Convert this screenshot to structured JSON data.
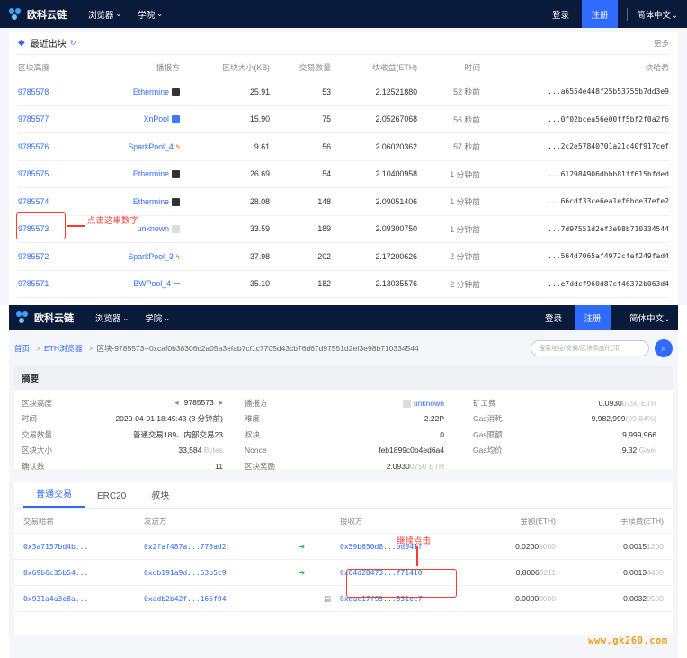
{
  "nav": {
    "logo": "欧科云链",
    "browser": "浏览器",
    "academy": "学院",
    "login": "登录",
    "register": "注册",
    "lang": "简体中文"
  },
  "recent": {
    "title": "最近出块",
    "more": "更多",
    "headers": [
      "区块高度",
      "播报方",
      "区块大小(KB)",
      "交易数量",
      "块收益(ETH)",
      "时间",
      "块哈希"
    ],
    "rows": [
      {
        "height": "9785578",
        "miner": "Ethermine",
        "icon": "dark",
        "size": "25.91",
        "txs": "53",
        "reward": "2.12521880",
        "time": "52 秒前",
        "hash": "...a6554e448f25b53755b7dd3e9"
      },
      {
        "height": "9785577",
        "miner": "XnPool",
        "icon": "blue",
        "size": "15.90",
        "txs": "75",
        "reward": "2.05267068",
        "time": "56 秒前",
        "hash": "...0f02bcea56e00ff5bf2f0a2f6"
      },
      {
        "height": "9785576",
        "miner": "SparkPool_4",
        "icon": "fire",
        "size": "9.61",
        "txs": "56",
        "reward": "2.06020362",
        "time": "57 秒前",
        "hash": "...2c2e57840701a21c40f917cef"
      },
      {
        "height": "9785575",
        "miner": "Ethermine",
        "icon": "dark",
        "size": "26.69",
        "txs": "54",
        "reward": "2.10400958",
        "time": "1 分钟前",
        "hash": "...612984906dbbb81ff615bfded"
      },
      {
        "height": "9785574",
        "miner": "Ethermine",
        "icon": "dark",
        "size": "28.08",
        "txs": "148",
        "reward": "2.09051406",
        "time": "1 分钟前",
        "hash": "...66cdf33ce6ea1ef6bde37efe2"
      },
      {
        "height": "9785573",
        "miner": "unknown",
        "icon": "light",
        "size": "33.59",
        "txs": "189",
        "reward": "2.09300750",
        "time": "1 分钟前",
        "hash": "...7d97551d2ef3e98b710334544"
      },
      {
        "height": "9785572",
        "miner": "SparkPool_3",
        "icon": "fire",
        "size": "37.98",
        "txs": "202",
        "reward": "2.17200626",
        "time": "2 分钟前",
        "hash": "...564d7065af4972cfef249fad4"
      },
      {
        "height": "9785571",
        "miner": "BWPool_4",
        "icon": "gray",
        "size": "35.10",
        "txs": "182",
        "reward": "2.13035576",
        "time": "2 分钟前",
        "hash": "...e7ddcf960d87cf46372b063d4"
      }
    ]
  },
  "annotations": {
    "click_number": "点击这串数字",
    "continue_click": "继续点击"
  },
  "detail": {
    "breadcrumb": {
      "home": "首页",
      "eth": "ETH浏览器",
      "current": "区块-9785573--0xcaf0b38306c2a05a3efab7cf1c7705d43cb76d67d97551d2ef3e98b710334544"
    },
    "search_placeholder": "搜索地址/交易/区块高度/代币",
    "summary_title": "摘要",
    "col1": [
      {
        "k": "区块高度",
        "v": "9785573"
      },
      {
        "k": "时间",
        "v": "2020-04-01 18:45:43 (3 分钟前)"
      },
      {
        "k": "交易数量",
        "v": "普通交易189、内部交易23"
      },
      {
        "k": "区块大小",
        "v": "33,584",
        "u": "Bytes"
      },
      {
        "k": "确认数",
        "v": "11"
      }
    ],
    "col2": [
      {
        "k": "播报方",
        "v": "unknown"
      },
      {
        "k": "难度",
        "v": "2.22P"
      },
      {
        "k": "叔块",
        "v": "0"
      },
      {
        "k": "Nonce",
        "v": "feb1899c0b4ed6a4"
      },
      {
        "k": "区块奖励",
        "v": "2.0930",
        "d": "0750",
        "u": "ETH"
      }
    ],
    "col3": [
      {
        "k": "矿工费",
        "v": "0.0930",
        "d": "0750",
        "u": "ETH"
      },
      {
        "k": "Gas消耗",
        "v": "9,982,999",
        "d": "(99.84%)"
      },
      {
        "k": "Gas限额",
        "v": "9,999,966"
      },
      {
        "k": "Gas均价",
        "v": "9.32",
        "u": "Gwei"
      }
    ],
    "tabs": [
      "普通交易",
      "ERC20",
      "叔块"
    ],
    "tx_headers": [
      "交易哈希",
      "发送方",
      "接收方",
      "金额(ETH)",
      "手续费(ETH)"
    ],
    "txs": [
      {
        "hash": "0x3a7157bd4b...",
        "from": "0x2faf487a...776ad2",
        "to": "0x59b650d8...bd041f",
        "amt": "0.0200",
        "amt_d": "0000",
        "fee": "0.0015",
        "fee_d": "1200"
      },
      {
        "hash": "0x69b6c35b54...",
        "from": "0xdb191a9d...53b5c9",
        "to": "0x04d28473...f71410",
        "amt": "0.8006",
        "amt_d": "0211",
        "fee": "0.0013",
        "fee_d": "4400"
      },
      {
        "hash": "0x931a4a3e8a...",
        "from": "0xadb2b42f...166f94",
        "to": "0xdac17f95...831ec7",
        "amt": "0.0000",
        "amt_d": "0000",
        "fee": "0.0032",
        "fee_d": "0500"
      }
    ]
  },
  "watermark": "www.gk260.com"
}
